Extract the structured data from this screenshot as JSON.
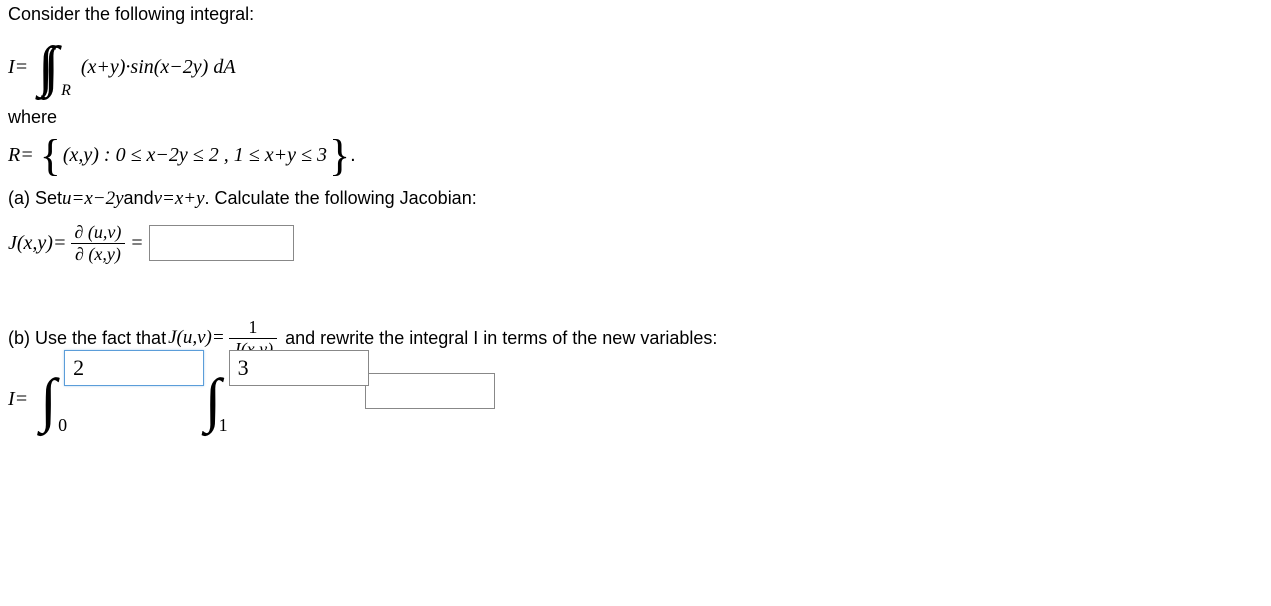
{
  "intro": "Consider the following integral:",
  "I_label": "I=",
  "integrand": "(x+y)·sin(x−2y) dA",
  "int_sub": "R",
  "where": "where",
  "R_label": "R=",
  "region_text": "(x,y) : 0 ≤ x−2y ≤ 2 , 1 ≤ x+y ≤ 3",
  "region_end": ".",
  "part_a_prefix": "(a) Set  ",
  "part_a_u": "u=x−2y",
  "part_a_and": " and ",
  "part_a_v": "v=x+y",
  "part_a_suffix": ". Calculate the following Jacobian:",
  "jacobian_lhs": "J(x,y)=",
  "jacobian_num": "∂ (u,v)",
  "jacobian_den": "∂ (x,y)",
  "equals": "=",
  "part_b_prefix": "(b) Use the fact that  ",
  "part_b_juv": "J(u,v)=",
  "part_b_frac_num": "1",
  "part_b_frac_den": "J(x,y)",
  "part_b_suffix": " and rewrite the integral I in terms of the new variables:",
  "outer_lower": "0",
  "outer_upper": "2",
  "inner_lower": "1",
  "inner_upper": "3"
}
